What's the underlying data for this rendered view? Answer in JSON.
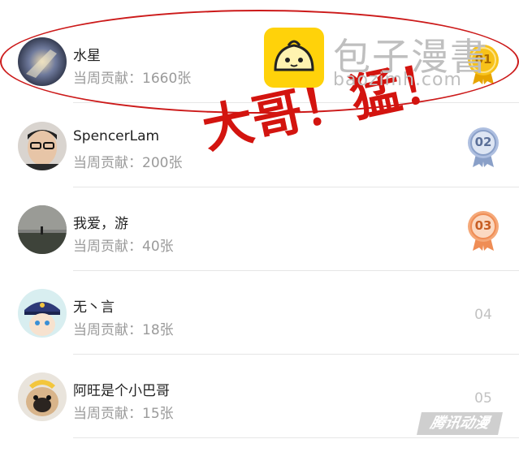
{
  "leaderboard": {
    "contribution_label": "当周贡献：",
    "rows": [
      {
        "rank": "01",
        "name": "水星",
        "contribution": "当周贡献：1660张",
        "medal": "gold"
      },
      {
        "rank": "02",
        "name": "SpencerLam",
        "contribution": "当周贡献：200张",
        "medal": "silver"
      },
      {
        "rank": "03",
        "name": "我爱，游",
        "contribution": "当周贡献：40张",
        "medal": "bronze"
      },
      {
        "rank": "04",
        "name": "无丶言",
        "contribution": "当周贡献：18张",
        "medal": ""
      },
      {
        "rank": "05",
        "name": "阿旺是个小巴哥",
        "contribution": "当周贡献：15张",
        "medal": ""
      }
    ]
  },
  "overlay": {
    "caption": "大哥！猛！",
    "caption_color": "#d3140f"
  },
  "watermark": {
    "title": "包子漫書",
    "url": "baozimh.com",
    "corner": "腾讯动漫"
  },
  "colors": {
    "gold": "#f4b400",
    "silver": "#7f97c4",
    "bronze": "#f0925d",
    "plain_rank": "#c2c2c2"
  }
}
